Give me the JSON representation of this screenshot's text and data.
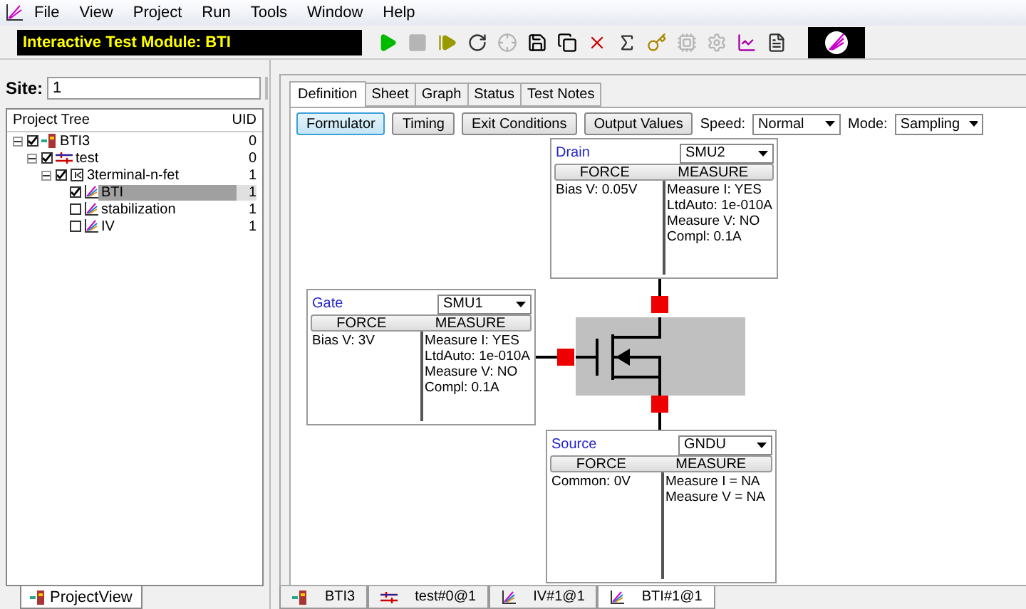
{
  "menu": [
    "File",
    "View",
    "Project",
    "Run",
    "Tools",
    "Window",
    "Help"
  ],
  "module_label": "Interactive Test Module: BTI",
  "toolbar": [
    {
      "kind": "run",
      "disabled": false
    },
    {
      "kind": "stop",
      "disabled": true
    },
    {
      "kind": "step",
      "disabled": false
    },
    {
      "kind": "repeat",
      "disabled": false
    },
    {
      "kind": "target",
      "disabled": true
    },
    {
      "kind": "save",
      "disabled": false
    },
    {
      "kind": "saveall",
      "disabled": false
    },
    {
      "kind": "delete",
      "disabled": false
    },
    {
      "kind": "formula",
      "disabled": false
    },
    {
      "kind": "key",
      "disabled": false
    },
    {
      "kind": "circuit",
      "disabled": true
    },
    {
      "kind": "gear",
      "disabled": true
    },
    {
      "kind": "chart",
      "disabled": false
    },
    {
      "kind": "doc",
      "disabled": false
    },
    {
      "kind": "logo",
      "disabled": false
    }
  ],
  "site": {
    "label": "Site:",
    "value": "1"
  },
  "project_tree": {
    "columns": [
      "Project Tree",
      "UID"
    ],
    "items": [
      {
        "label": "BTI3",
        "uid": "0",
        "kind": "project",
        "checked": true,
        "expanded": true,
        "selected": false,
        "children": [
          {
            "label": "test",
            "uid": "0",
            "kind": "plan",
            "checked": true,
            "expanded": true,
            "selected": false,
            "children": [
              {
                "label": "3terminal-n-fet",
                "uid": "1",
                "kind": "device",
                "checked": true,
                "expanded": true,
                "selected": false,
                "children": [
                  {
                    "label": "BTI",
                    "uid": "1",
                    "kind": "test",
                    "checked": true,
                    "selected": true
                  },
                  {
                    "label": "stabilization",
                    "uid": "1",
                    "kind": "test",
                    "checked": false,
                    "selected": false
                  },
                  {
                    "label": "IV",
                    "uid": "1",
                    "kind": "test",
                    "checked": false,
                    "selected": false
                  }
                ]
              }
            ]
          }
        ]
      }
    ]
  },
  "left_tab": "ProjectView",
  "tabs": [
    {
      "label": "Definition",
      "selected": true
    },
    {
      "label": "Sheet",
      "selected": false
    },
    {
      "label": "Graph",
      "selected": false
    },
    {
      "label": "Status",
      "selected": false
    },
    {
      "label": "Test Notes",
      "selected": false
    }
  ],
  "buttons": [
    {
      "label": "Formulator",
      "selected": true
    },
    {
      "label": "Timing",
      "selected": false
    },
    {
      "label": "Exit Conditions",
      "selected": false
    },
    {
      "label": "Output Values",
      "selected": false
    }
  ],
  "speed": {
    "label": "Speed:",
    "value": "Normal"
  },
  "mode": {
    "label": "Mode:",
    "value": "Sampling"
  },
  "terminals": [
    {
      "kind": "top",
      "name": "Drain",
      "instrument": "SMU2",
      "force_header": "FORCE",
      "measure_header": "MEASURE",
      "force": [
        "Bias V: 0.05V"
      ],
      "measure": [
        "Measure I: YES",
        "LtdAuto: 1e-010A",
        "Measure V: NO",
        "Compl: 0.1A"
      ]
    },
    {
      "kind": "left",
      "name": "Gate",
      "instrument": "SMU1",
      "force_header": "FORCE",
      "measure_header": "MEASURE",
      "force": [
        "Bias V: 3V"
      ],
      "measure": [
        "Measure I: YES",
        "LtdAuto: 1e-010A",
        "Measure V: NO",
        "Compl: 0.1A"
      ]
    },
    {
      "kind": "bottom",
      "name": "Source",
      "instrument": "GNDU",
      "force_header": "FORCE",
      "measure_header": "MEASURE",
      "force": [
        "Common: 0V"
      ],
      "measure": [
        "Measure I = NA",
        "Measure V = NA"
      ]
    }
  ],
  "doc_tabs": [
    {
      "label": "BTI3",
      "kind": "project",
      "selected": false
    },
    {
      "label": "test#0@1",
      "kind": "plan",
      "selected": false
    },
    {
      "label": "IV#1@1",
      "kind": "test",
      "selected": false
    },
    {
      "label": "BTI#1@1",
      "kind": "test",
      "selected": true
    }
  ]
}
